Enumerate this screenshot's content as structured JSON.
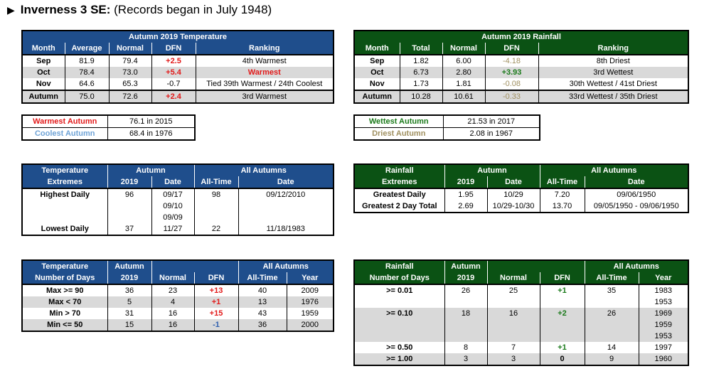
{
  "header": {
    "arrow_icon": "▶",
    "station": "Inverness 3 SE:",
    "note": "(Records began in July 1948)"
  },
  "temp_monthly": {
    "title": "Autumn 2019 Temperature",
    "columns": [
      "Month",
      "Average",
      "Normal",
      "DFN",
      "Ranking"
    ],
    "rows": [
      {
        "month": "Sep",
        "average": "81.9",
        "normal": "79.4",
        "dfn": "+2.5",
        "ranking": "4th Warmest"
      },
      {
        "month": "Oct",
        "average": "78.4",
        "normal": "73.0",
        "dfn": "+5.4",
        "ranking": "Warmest"
      },
      {
        "month": "Nov",
        "average": "64.6",
        "normal": "65.3",
        "dfn": "-0.7",
        "ranking": "Tied 39th Warmest / 24th Coolest"
      },
      {
        "month": "Autumn",
        "average": "75.0",
        "normal": "72.6",
        "dfn": "+2.4",
        "ranking": "3rd Warmest"
      }
    ]
  },
  "rain_monthly": {
    "title": "Autumn 2019 Rainfall",
    "columns": [
      "Month",
      "Total",
      "Normal",
      "DFN",
      "Ranking"
    ],
    "rows": [
      {
        "month": "Sep",
        "total": "1.82",
        "normal": "6.00",
        "dfn": "-4.18",
        "ranking": "8th Driest"
      },
      {
        "month": "Oct",
        "total": "6.73",
        "normal": "2.80",
        "dfn": "+3.93",
        "ranking": "3rd Wettest"
      },
      {
        "month": "Nov",
        "total": "1.73",
        "normal": "1.81",
        "dfn": "-0.08",
        "ranking": "30th Wettest / 41st Driest"
      },
      {
        "month": "Autumn",
        "total": "10.28",
        "normal": "10.61",
        "dfn": "-0.33",
        "ranking": "33rd Wettest / 35th Driest"
      }
    ]
  },
  "temp_records": {
    "warmest_label": "Warmest Autumn",
    "warmest_value": "76.1 in 2015",
    "coolest_label": "Coolest Autumn",
    "coolest_value": "68.4 in 1976"
  },
  "rain_records": {
    "wettest_label": "Wettest Autumn",
    "wettest_value": "21.53 in 2017",
    "driest_label": "Driest Autumn",
    "driest_value": "2.08 in 1967"
  },
  "temp_extremes": {
    "h1": "Temperature",
    "h2": "Extremes",
    "group1": "Autumn",
    "group2": "All Autumns",
    "cols": [
      "2019",
      "Date",
      "All-Time",
      "Date"
    ],
    "highest": {
      "label": "Highest Daily",
      "val": "96",
      "dates": [
        "09/17",
        "09/10",
        "09/09"
      ],
      "alltime": "98",
      "alldate": "09/12/2010"
    },
    "lowest": {
      "label": "Lowest Daily",
      "val": "37",
      "date": "11/27",
      "alltime": "22",
      "alldate": "11/18/1983"
    }
  },
  "rain_extremes": {
    "h1": "Rainfall",
    "h2": "Extremes",
    "group1": "Autumn",
    "group2": "All Autumns",
    "cols": [
      "2019",
      "Date",
      "All-Time",
      "Date"
    ],
    "rows": [
      {
        "label": "Greatest Daily",
        "val": "1.95",
        "date": "10/29",
        "alltime": "7.20",
        "alldate": "09/06/1950"
      },
      {
        "label": "Greatest 2 Day Total",
        "val": "2.69",
        "date": "10/29-10/30",
        "alltime": "13.70",
        "alldate": "09/05/1950 - 09/06/1950"
      }
    ]
  },
  "temp_days": {
    "h1": "Temperature",
    "h2": "Number of Days",
    "autumn_h1": "Autumn",
    "autumn_h2": "2019",
    "normal": "Normal",
    "dfn": "DFN",
    "group2": "All Autumns",
    "alltime": "All-Time",
    "year": "Year",
    "rows": [
      {
        "label": "Max >= 90",
        "val": "36",
        "normal": "23",
        "dfn": "+13",
        "alltime": "40",
        "year": "2009"
      },
      {
        "label": "Max < 70",
        "val": "5",
        "normal": "4",
        "dfn": "+1",
        "alltime": "13",
        "year": "1976"
      },
      {
        "label": "Min > 70",
        "val": "31",
        "normal": "16",
        "dfn": "+15",
        "alltime": "43",
        "year": "1959"
      },
      {
        "label": "Min <= 50",
        "val": "15",
        "normal": "16",
        "dfn": "-1",
        "alltime": "36",
        "year": "2000"
      }
    ]
  },
  "rain_days": {
    "h1": "Rainfall",
    "h2": "Number of Days",
    "autumn_h1": "Autumn",
    "autumn_h2": "2019",
    "normal": "Normal",
    "dfn": "DFN",
    "group2": "All Autumns",
    "alltime": "All-Time",
    "year": "Year",
    "rows": [
      {
        "label": ">= 0.01",
        "val": "26",
        "normal": "25",
        "dfn": "+1",
        "alltime": "35",
        "years": [
          "1983",
          "1953"
        ]
      },
      {
        "label": ">= 0.10",
        "val": "18",
        "normal": "16",
        "dfn": "+2",
        "alltime": "26",
        "years": [
          "1969",
          "1959",
          "1953"
        ]
      },
      {
        "label": ">= 0.50",
        "val": "8",
        "normal": "7",
        "dfn": "+1",
        "alltime": "14",
        "years": [
          "1997"
        ]
      },
      {
        "label": ">= 1.00",
        "val": "3",
        "normal": "3",
        "dfn": "0",
        "alltime": "9",
        "years": [
          "1960"
        ]
      }
    ]
  },
  "colors": {
    "temp_header": "#1f4e8c",
    "rain_header": "#0b5214",
    "warm_red": "#e21a1a",
    "cool_blue": "#6fa3d6",
    "wet_green": "#1a7a1a",
    "dry_olive": "#a09060",
    "alt_row": "#d9d9d9"
  }
}
